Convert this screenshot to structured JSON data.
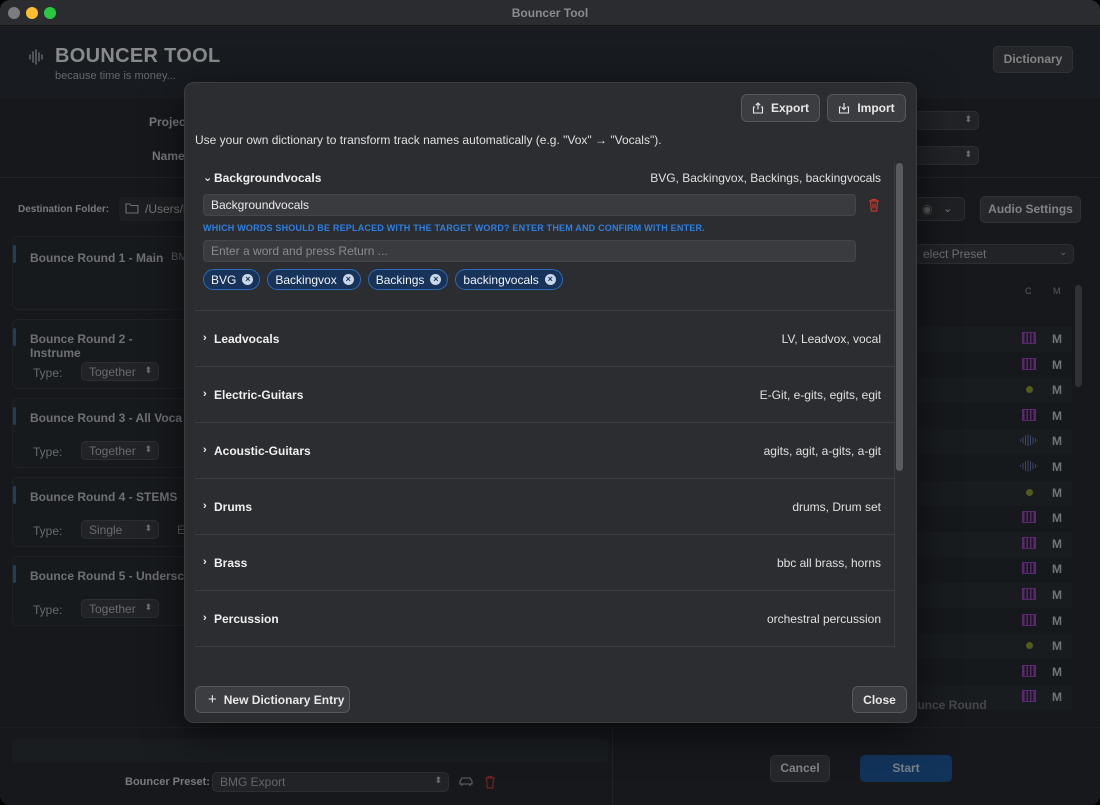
{
  "window": {
    "title": "Bouncer Tool"
  },
  "app": {
    "title": "BOUNCER TOOL",
    "subtitle": "because time is money...",
    "dictionary_button": "Dictionary",
    "project_label": "Projec",
    "name_label": "Name",
    "destination_label": "Destination Folder:",
    "destination_value": "/Users/l",
    "audio_settings_button": "Audio Settings",
    "select_preset": "elect Preset",
    "rounds": [
      {
        "title": "Bounce Round 1 - Main",
        "extra": "BM"
      },
      {
        "title": "Bounce Round 2 - Instrume",
        "type_label": "Type:",
        "type_value": "Together"
      },
      {
        "title": "Bounce Round 3 - All Voca",
        "type_label": "Type:",
        "type_value": "Together"
      },
      {
        "title": "Bounce Round 4 - STEMS",
        "type_label": "Type:",
        "type_value": "Single",
        "extra": "E"
      },
      {
        "title": "Bounce Round 5 - Undersc",
        "type_label": "Type:",
        "type_value": "Together"
      }
    ],
    "col_c": "C",
    "col_m": "M",
    "m_label": "M",
    "add_round_label": "unce Round",
    "preset_label": "Bouncer Preset:",
    "preset_value": "BMG Export",
    "cancel_button": "Cancel",
    "start_button": "Start"
  },
  "dialog": {
    "export_button": "Export",
    "import_button": "Import",
    "description": "Use your own dictionary to transform track names automatically (e.g. \"Vox\" → \"Vocals\").",
    "expanded_entry": {
      "name": "Backgroundvocals",
      "synonyms": "BVG, Backingvox, Backings, backingvocals",
      "target_value": "Backgroundvocals",
      "hint": "WHICH WORDS SHOULD BE REPLACED WITH THE TARGET WORD? ENTER THEM AND CONFIRM WITH ENTER.",
      "word_placeholder": "Enter a word and press Return ...",
      "chips": [
        "BVG",
        "Backingvox",
        "Backings",
        "backingvocals"
      ]
    },
    "entries": [
      {
        "name": "Leadvocals",
        "synonyms": "LV, Leadvox, vocal"
      },
      {
        "name": "Electric-Guitars",
        "synonyms": "E-Git, e-gits, egits, egit"
      },
      {
        "name": "Acoustic-Guitars",
        "synonyms": "agits, agit, a-gits, a-git"
      },
      {
        "name": "Drums",
        "synonyms": "drums, Drum set"
      },
      {
        "name": "Brass",
        "synonyms": "bbc all brass, horns"
      },
      {
        "name": "Percussion",
        "synonyms": "orchestral percussion"
      }
    ],
    "new_entry_button": "New Dictionary Entry",
    "close_button": "Close"
  }
}
